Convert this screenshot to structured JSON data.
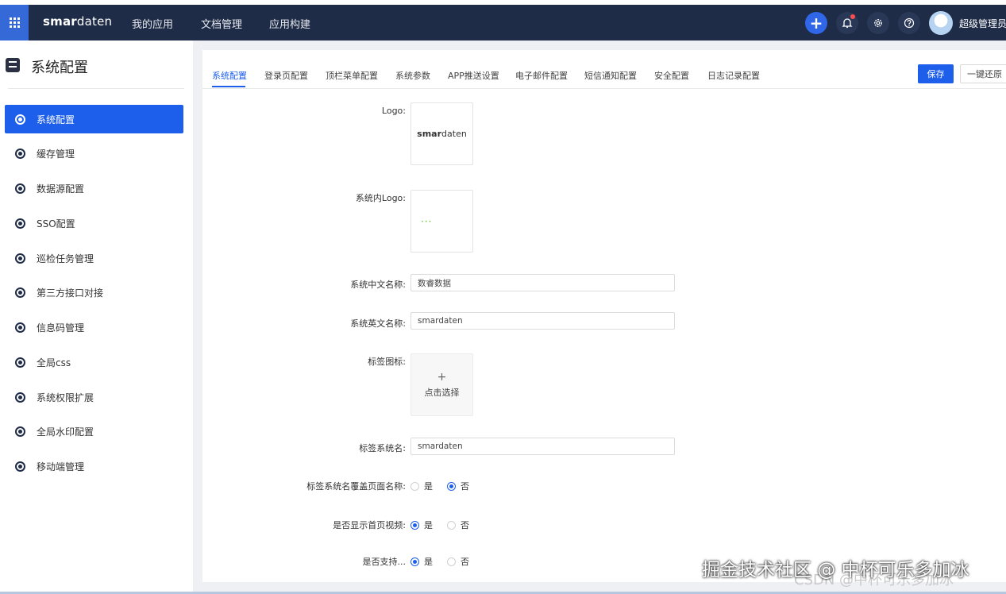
{
  "topbar": {
    "brand_bold": "smar",
    "brand_rest": "daten",
    "nav": [
      "我的应用",
      "文档管理",
      "应用构建"
    ],
    "username": "超级管理员",
    "icons": [
      "grid-icon",
      "plus-icon",
      "bell-icon",
      "gear-icon",
      "help-icon"
    ],
    "accent": "#2f67e8",
    "bg": "#1f2c47"
  },
  "sidebar": {
    "title": "系统配置",
    "items": [
      {
        "label": "系统配置",
        "active": true
      },
      {
        "label": "缓存管理"
      },
      {
        "label": "数据源配置"
      },
      {
        "label": "SSO配置"
      },
      {
        "label": "巡检任务管理"
      },
      {
        "label": "第三方接口对接"
      },
      {
        "label": "信息码管理"
      },
      {
        "label": "全局css"
      },
      {
        "label": "系统权限扩展"
      },
      {
        "label": "全局水印配置"
      },
      {
        "label": "移动端管理"
      }
    ]
  },
  "tabs": [
    "系统配置",
    "登录页配置",
    "顶栏菜单配置",
    "系统参数",
    "APP推送设置",
    "电子邮件配置",
    "短信通知配置",
    "安全配置",
    "日志记录配置"
  ],
  "actions": {
    "save": "保存",
    "restore": "一键还原"
  },
  "form": {
    "logo_label": "Logo:",
    "inner_logo_label": "系统内Logo:",
    "inner_logo_dots": "···",
    "cn_name_label": "系统中文名称:",
    "cn_name_value": "数睿数据",
    "en_name_label": "系统英文名称:",
    "en_name_value": "smardaten",
    "tab_icon_label": "标签图标:",
    "upload_plus": "+",
    "upload_text": "点击选择",
    "tab_name_label": "标签系统名:",
    "tab_name_value": "smardaten",
    "override_label": "标签系统名覆盖页面名称:",
    "override_yes": "是",
    "override_no": "否",
    "override_value": "否",
    "video_label": "是否显示首页视频:",
    "video_yes": "是",
    "video_no": "否",
    "video_value": "是",
    "partial_label": "是否支持...",
    "partial_yes": "是",
    "partial_no": "否"
  },
  "watermark": {
    "line1": "掘金技术社区 @ 中杯可乐多加冰",
    "line2": "CSDN @中杯可乐多加冰"
  }
}
